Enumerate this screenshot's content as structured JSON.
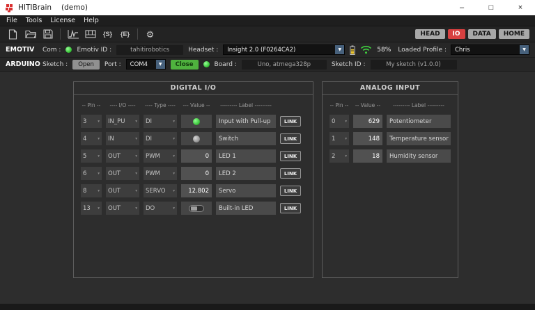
{
  "window": {
    "title": "HITIBrain",
    "demo_label": "(demo)",
    "controls": {
      "minimize": "–",
      "maximize": "□",
      "close": "×"
    }
  },
  "menu": {
    "items": [
      "File",
      "Tools",
      "License",
      "Help"
    ]
  },
  "toolbar": {
    "script_s_label": "{S}",
    "script_e_label": "{E}",
    "gear_glyph": "⚙",
    "nav": {
      "head": "HEAD",
      "io": "IO",
      "data": "DATA",
      "home": "HOME"
    }
  },
  "emotiv": {
    "section_label": "EMOTIV",
    "com_label": "Com :",
    "id_label": "Emotiv ID :",
    "id_value": "tahitirobotics",
    "headset_label": "Headset :",
    "headset_value": "Insight 2.0 (F0264CA2)",
    "battery_level": "58%",
    "profile_label": "Loaded Profile :",
    "profile_value": "Chris"
  },
  "arduino": {
    "section_label": "ARDUINO",
    "sketch_label": "Sketch :",
    "open_button": "Open",
    "port_label": "Port :",
    "port_value": "COM4",
    "close_button": "Close",
    "board_label": "Board :",
    "board_value": "Uno, atmega328p",
    "sketch_id_label": "Sketch ID :",
    "sketch_id_value": "My sketch (v1.0.0)"
  },
  "digital_io": {
    "title": "DIGITAL  I/O",
    "headers": {
      "pin": "-- Pin --",
      "io": "---- I/O ----",
      "type": "---- Type ----",
      "value": "--- Value --",
      "label": "--------- Label ---------"
    },
    "link_label": "LINK",
    "rows": [
      {
        "pin": "3",
        "io": "IN_PU",
        "type": "DI",
        "value": "on",
        "label": "Input with Pull-up"
      },
      {
        "pin": "4",
        "io": "IN",
        "type": "DI",
        "value": "off",
        "label": "Switch"
      },
      {
        "pin": "5",
        "io": "OUT",
        "type": "PWM",
        "value": "0",
        "label": "LED 1"
      },
      {
        "pin": "6",
        "io": "OUT",
        "type": "PWM",
        "value": "0",
        "label": "LED 2"
      },
      {
        "pin": "8",
        "io": "OUT",
        "type": "SERVO",
        "value": "12.802",
        "label": "Servo"
      },
      {
        "pin": "13",
        "io": "OUT",
        "type": "DO",
        "value": "toggle-off",
        "label": "Built-in LED"
      }
    ]
  },
  "analog_input": {
    "title": "ANALOG  INPUT",
    "headers": {
      "pin": "-- Pin --",
      "value": "-- Value --",
      "label": "--------- Label ---------"
    },
    "rows": [
      {
        "pin": "0",
        "value": "629",
        "label": "Potentiometer"
      },
      {
        "pin": "1",
        "value": "148",
        "label": "Temperature sensor"
      },
      {
        "pin": "2",
        "value": "18",
        "label": "Humidity sensor"
      }
    ]
  },
  "colors": {
    "led_on": "#3ccf3c",
    "led_off": "#9a9a9a",
    "io_active": "#d84040",
    "close_green": "#4fb23e",
    "wifi_green": "#3fd13f",
    "battery_yellow": "#e8c330"
  }
}
